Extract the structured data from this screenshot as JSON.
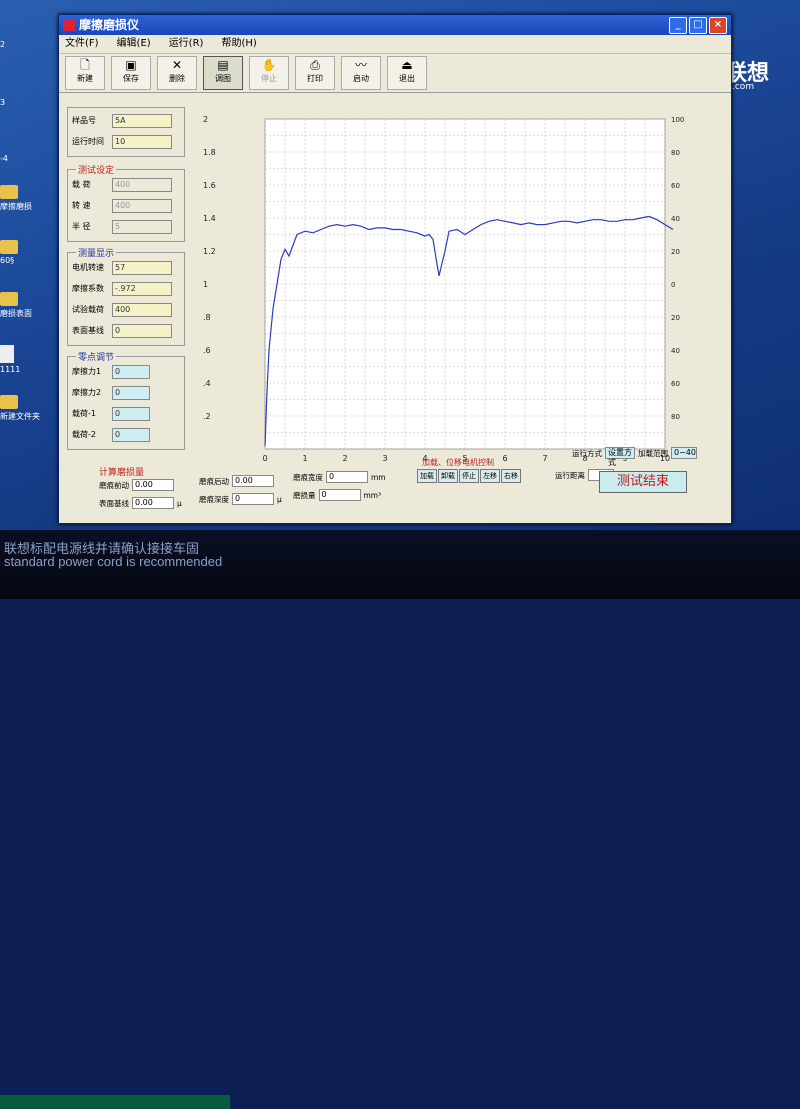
{
  "window": {
    "title": "摩擦磨损仪"
  },
  "menu": [
    "文件(F)",
    "编辑(E)",
    "运行(R)",
    "帮助(H)"
  ],
  "toolbar": [
    {
      "label": "新建",
      "icon": "new-file-icon"
    },
    {
      "label": "保存",
      "icon": "save-icon"
    },
    {
      "label": "删除",
      "icon": "delete-icon"
    },
    {
      "label": "调图",
      "icon": "load-graph-icon"
    },
    {
      "label": "停止",
      "icon": "stop-icon"
    },
    {
      "label": "打印",
      "icon": "print-icon"
    },
    {
      "label": "启动",
      "icon": "start-icon"
    },
    {
      "label": "退出",
      "icon": "exit-icon"
    }
  ],
  "sample": {
    "id_label": "样品号",
    "id_value": "5A",
    "time_label": "运行时间",
    "time_value": "10"
  },
  "test_settings": {
    "title": "测试设定",
    "load_label": "载  荷",
    "load_value": "400",
    "speed_label": "转  速",
    "speed_value": "400",
    "radius_label": "半  径",
    "radius_value": "5"
  },
  "measure_display": {
    "title": "测量显示",
    "motor_label": "电机转速",
    "motor_value": "57",
    "friction_label": "摩擦系数",
    "friction_value": "-.972",
    "testload_label": "试验载荷",
    "testload_value": "400",
    "surface_label": "表面基线",
    "surface_value": "0"
  },
  "zero_adjust": {
    "title": "零点调节",
    "f1_label": "摩擦力1",
    "f1_value": "0",
    "f2_label": "摩擦力2",
    "f2_value": "0",
    "l1_label": "载荷-1",
    "l1_value": "0",
    "l2_label": "载荷-2",
    "l2_value": "0"
  },
  "calc": {
    "title": "计算磨损量",
    "before_label": "磨痕前动",
    "before_value": "0.00",
    "after_label": "磨痕后动",
    "after_value": "0.00",
    "width_label": "磨痕宽度",
    "width_value": "0",
    "base_label": "表面基线",
    "base_value": "0.00",
    "depth_label": "磨痕深度",
    "depth_value": "0",
    "wear_label": "磨损量",
    "wear_value": "0",
    "unit_mm": "mm",
    "unit_mu": "μ",
    "unit_mm3": "mm³"
  },
  "load_ctrl": {
    "title": "加载、位移电机控制",
    "buttons": [
      "加载",
      "卸载",
      "停止",
      "左移",
      "右移"
    ],
    "distance_label": "运行距离",
    "distance_unit": "mm"
  },
  "run_mode": {
    "mode_label": "运行方式",
    "mode_value": "设置方式",
    "range_label": "加载范围",
    "range_value": "0~40"
  },
  "end_button": "测试结束",
  "desktop": {
    "icons": [
      "2",
      "3",
      "-4",
      "摩擦磨损",
      "60§",
      "磨损表面",
      "1111",
      "新建文件夹"
    ],
    "brand": "联想",
    "brand_url": ".com",
    "bezel_line1": "联想标配电源线并请确认接接车固",
    "bezel_line2": "standard power cord is recommended"
  },
  "chart_data": {
    "type": "line",
    "xlim": [
      0,
      10
    ],
    "ylim": [
      0,
      2
    ],
    "x_ticks": [
      "0",
      "1",
      "2",
      "3",
      "4",
      "5",
      "6",
      "7",
      "8",
      "9",
      "10"
    ],
    "y_ticks": [
      ".2",
      ".4",
      ".6",
      ".8",
      "1",
      "1.2",
      "1.4",
      "1.6",
      "1.8",
      "2"
    ],
    "y2_ticks": [
      "100",
      "80",
      "60",
      "40",
      "20",
      "0",
      "20",
      "40",
      "60",
      "80",
      "100"
    ],
    "grid": true,
    "line_color": "#2a3cc0",
    "series": [
      {
        "x": [
          0,
          0.05,
          0.1,
          0.2,
          0.3,
          0.4,
          0.5,
          0.6,
          0.8,
          1.0,
          1.2,
          1.4,
          1.6,
          1.8,
          2.0,
          2.2,
          2.4,
          2.6,
          2.8,
          3.0,
          3.2,
          3.4,
          3.6,
          3.8,
          4.0,
          4.1,
          4.2,
          4.3,
          4.35,
          4.4,
          4.5,
          4.6,
          4.8,
          5.0,
          5.2,
          5.4,
          5.6,
          5.8,
          6.0,
          6.2,
          6.4,
          6.6,
          6.8,
          7.0,
          7.2,
          7.4,
          7.6,
          7.8,
          8.0,
          8.2,
          8.4,
          8.6,
          8.8,
          9.0,
          9.2,
          9.4,
          9.6,
          9.8,
          10.0,
          10.2
        ],
        "y": [
          0.02,
          0.35,
          0.6,
          0.85,
          1.0,
          1.15,
          1.21,
          1.17,
          1.3,
          1.32,
          1.31,
          1.33,
          1.35,
          1.36,
          1.35,
          1.36,
          1.35,
          1.33,
          1.34,
          1.34,
          1.33,
          1.33,
          1.32,
          1.31,
          1.29,
          1.3,
          1.27,
          1.12,
          1.05,
          1.1,
          1.2,
          1.32,
          1.33,
          1.3,
          1.33,
          1.36,
          1.38,
          1.39,
          1.38,
          1.37,
          1.36,
          1.37,
          1.36,
          1.36,
          1.37,
          1.38,
          1.38,
          1.37,
          1.38,
          1.39,
          1.39,
          1.38,
          1.38,
          1.39,
          1.39,
          1.4,
          1.41,
          1.39,
          1.36,
          1.33
        ]
      }
    ]
  }
}
